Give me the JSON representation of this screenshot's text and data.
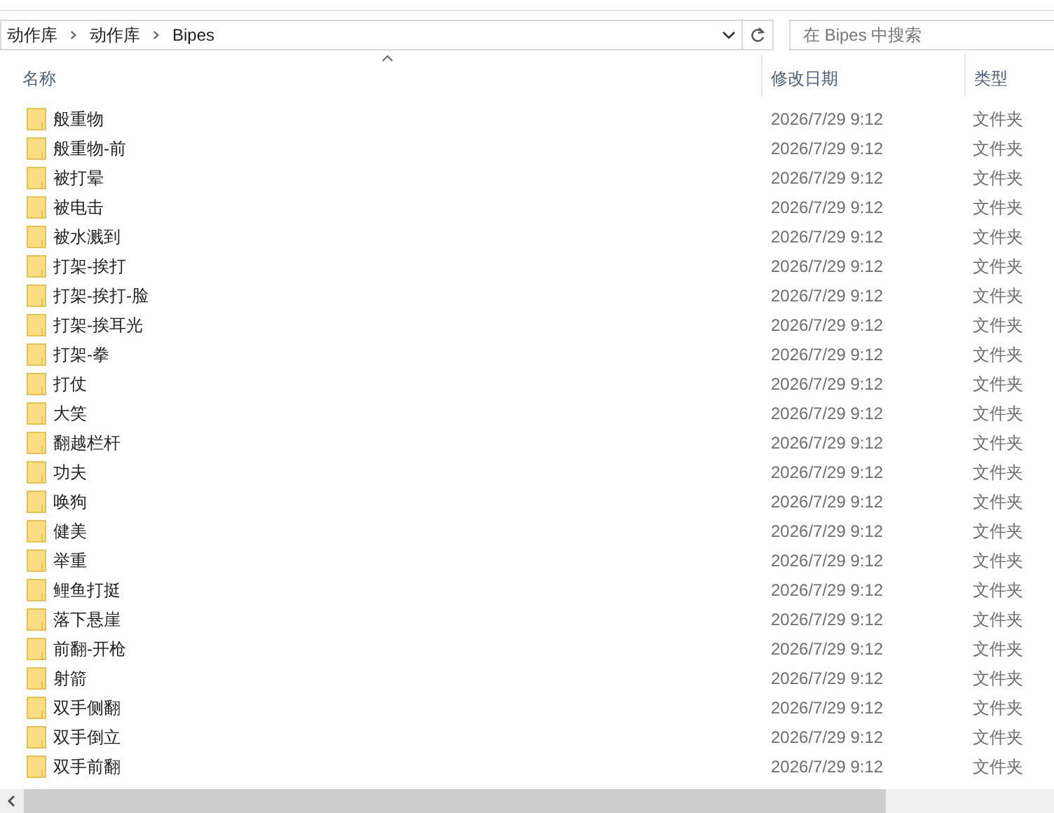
{
  "address_bar": {
    "breadcrumb": [
      "动作库",
      "动作库",
      "Bipes"
    ]
  },
  "search": {
    "placeholder": "在 Bipes 中搜索"
  },
  "columns": [
    {
      "label": "名称",
      "sorted": true
    },
    {
      "label": "修改日期",
      "sorted": false
    },
    {
      "label": "类型",
      "sorted": false
    }
  ],
  "rows": [
    {
      "name": "般重物",
      "modified": "2026/7/29 9:12",
      "type": "文件夹"
    },
    {
      "name": "般重物-前",
      "modified": "2026/7/29 9:12",
      "type": "文件夹"
    },
    {
      "name": "被打晕",
      "modified": "2026/7/29 9:12",
      "type": "文件夹"
    },
    {
      "name": "被电击",
      "modified": "2026/7/29 9:12",
      "type": "文件夹"
    },
    {
      "name": "被水溅到",
      "modified": "2026/7/29 9:12",
      "type": "文件夹"
    },
    {
      "name": "打架-挨打",
      "modified": "2026/7/29 9:12",
      "type": "文件夹"
    },
    {
      "name": "打架-挨打-脸",
      "modified": "2026/7/29 9:12",
      "type": "文件夹"
    },
    {
      "name": "打架-挨耳光",
      "modified": "2026/7/29 9:12",
      "type": "文件夹"
    },
    {
      "name": "打架-拳",
      "modified": "2026/7/29 9:12",
      "type": "文件夹"
    },
    {
      "name": "打仗",
      "modified": "2026/7/29 9:12",
      "type": "文件夹"
    },
    {
      "name": "大笑",
      "modified": "2026/7/29 9:12",
      "type": "文件夹"
    },
    {
      "name": "翻越栏杆",
      "modified": "2026/7/29 9:12",
      "type": "文件夹"
    },
    {
      "name": "功夫",
      "modified": "2026/7/29 9:12",
      "type": "文件夹"
    },
    {
      "name": "唤狗",
      "modified": "2026/7/29 9:12",
      "type": "文件夹"
    },
    {
      "name": "健美",
      "modified": "2026/7/29 9:12",
      "type": "文件夹"
    },
    {
      "name": "举重",
      "modified": "2026/7/29 9:12",
      "type": "文件夹"
    },
    {
      "name": "鲤鱼打挺",
      "modified": "2026/7/29 9:12",
      "type": "文件夹"
    },
    {
      "name": "落下悬崖",
      "modified": "2026/7/29 9:12",
      "type": "文件夹"
    },
    {
      "name": "前翻-开枪",
      "modified": "2026/7/29 9:12",
      "type": "文件夹"
    },
    {
      "name": "射箭",
      "modified": "2026/7/29 9:12",
      "type": "文件夹"
    },
    {
      "name": "双手侧翻",
      "modified": "2026/7/29 9:12",
      "type": "文件夹"
    },
    {
      "name": "双手倒立",
      "modified": "2026/7/29 9:12",
      "type": "文件夹"
    },
    {
      "name": "双手前翻",
      "modified": "2026/7/29 9:12",
      "type": "文件夹"
    }
  ]
}
